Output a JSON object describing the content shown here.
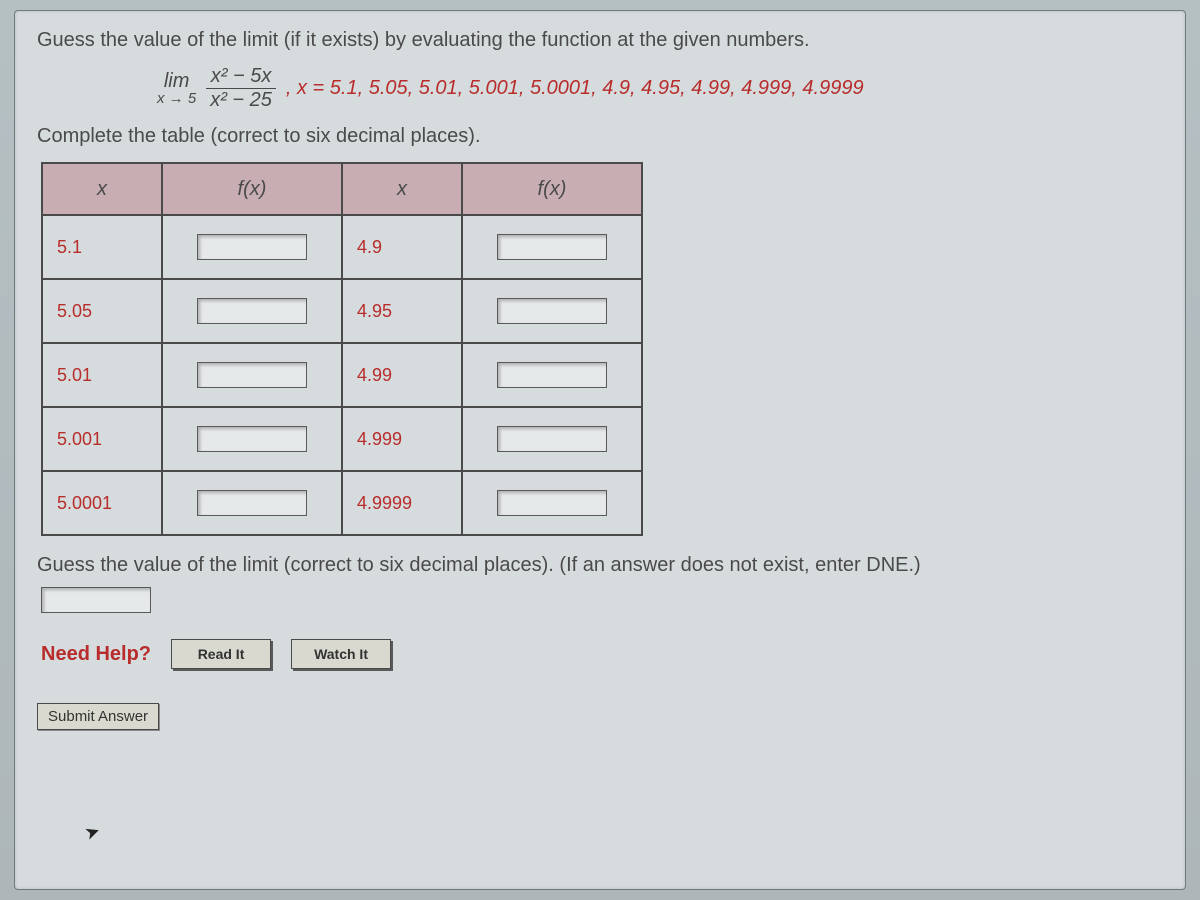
{
  "question": {
    "prompt": "Guess the value of the limit (if it exists) by evaluating the function at the given numbers.",
    "limit": {
      "lim_word": "lim",
      "lim_sub": "x → 5",
      "numerator": "x² − 5x",
      "denominator": "x² − 25"
    },
    "x_values_line": ", x = 5.1, 5.05, 5.01, 5.001, 5.0001, 4.9, 4.95, 4.99, 4.999, 4.9999",
    "complete_table": "Complete the table (correct to six decimal places).",
    "guess_line": "Guess the value of the limit (correct to six decimal places). (If an answer does not exist, enter DNE.)"
  },
  "table": {
    "headers": {
      "x": "x",
      "fx": "f(x)"
    },
    "rows": [
      {
        "x1": "5.1",
        "x2": "4.9"
      },
      {
        "x1": "5.05",
        "x2": "4.95"
      },
      {
        "x1": "5.01",
        "x2": "4.99"
      },
      {
        "x1": "5.001",
        "x2": "4.999"
      },
      {
        "x1": "5.0001",
        "x2": "4.9999"
      }
    ]
  },
  "help": {
    "label": "Need Help?",
    "read": "Read It",
    "watch": "Watch It"
  },
  "submit": {
    "label": "Submit Answer"
  }
}
